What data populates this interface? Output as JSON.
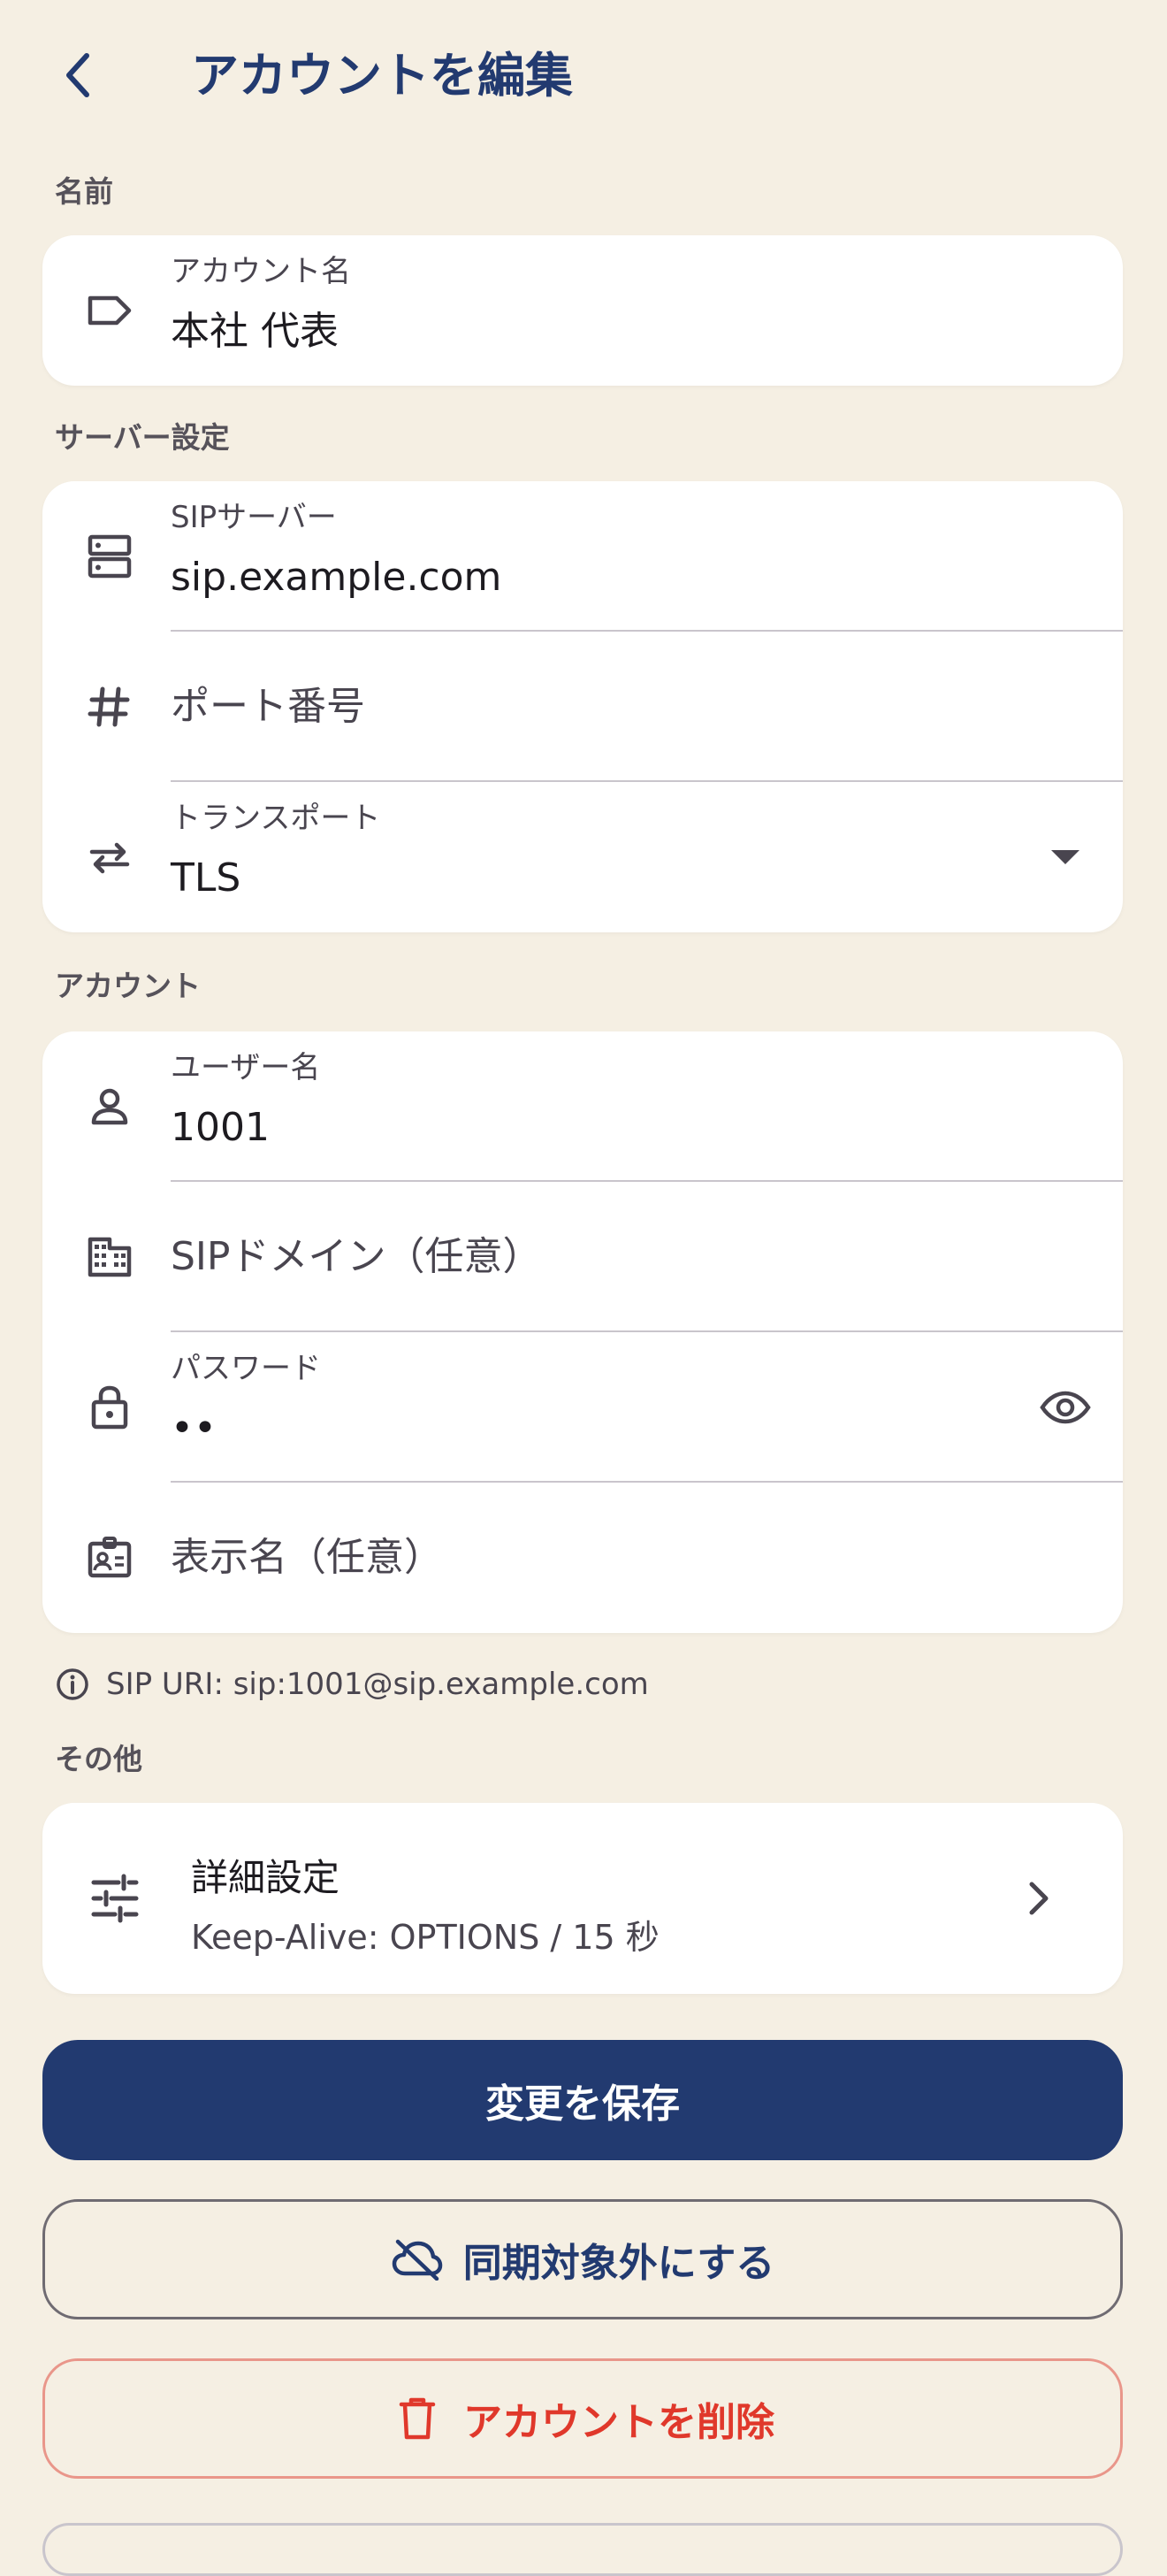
{
  "header": {
    "title": "アカウントを編集",
    "back_icon": "chevron-left-icon"
  },
  "sections": {
    "name": "名前",
    "server": "サーバー設定",
    "account": "アカウント",
    "other": "その他"
  },
  "name_card": {
    "account_name_label": "アカウント名",
    "account_name_value": "本社 代表"
  },
  "server_card": {
    "sip_server_label": "SIPサーバー",
    "sip_server_value": "sip.example.com",
    "port_placeholder": "ポート番号",
    "transport_label": "トランスポート",
    "transport_value": "TLS"
  },
  "account_card": {
    "username_label": "ユーザー名",
    "username_value": "1001",
    "domain_placeholder": "SIPドメイン（任意）",
    "password_label": "パスワード",
    "password_value": "••",
    "display_name_placeholder": "表示名（任意）"
  },
  "info": {
    "sip_uri": "SIP URI: sip:1001@sip.example.com"
  },
  "advanced": {
    "title": "詳細設定",
    "subtitle": "Keep-Alive: OPTIONS / 15 秒"
  },
  "buttons": {
    "save": "変更を保存",
    "unsync": "同期対象外にする",
    "delete": "アカウントを削除"
  },
  "colors": {
    "background": "#F5EFE3",
    "primary": "#223A70",
    "danger": "#E0382B",
    "danger_border": "#E9968A"
  }
}
